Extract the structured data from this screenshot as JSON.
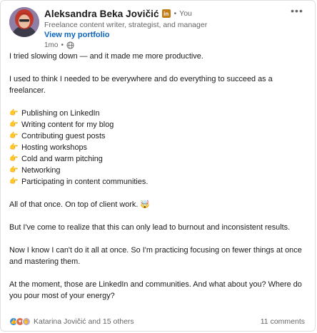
{
  "author": {
    "name": "Aleksandra Beka Jovičić",
    "badge": "in",
    "relation": "You",
    "headline": "Freelance content writer, strategist, and manager",
    "link": "View my portfolio",
    "time": "1mo",
    "visibility_icon": "globe-icon"
  },
  "menu_icon": "more-horizontal-icon",
  "post": {
    "intro": "I tried slowing down — and it made me more productive.",
    "p1": "I used to think I needed to be everywhere and do everything to succeed as a freelancer.",
    "bullet_icon": "👉",
    "bullets": [
      "Publishing on LinkedIn",
      "Writing content for my blog",
      "Contributing guest posts",
      "Hosting workshops",
      "Cold and warm pitching",
      "Networking",
      "Participating in content communities."
    ],
    "p2": "All of that once. On top of client work. 🤯",
    "p3": "But I've come to realize that this can only lead to burnout and inconsistent results.",
    "p4": "Now I know I can't do it all at once. So I'm practicing focusing on fewer things at once and mastering them.",
    "p5": "At the moment, those are LinkedIn and communities. And what about you? Where do you pour most of your energy?"
  },
  "footer": {
    "reaction_icons": [
      "like-icon",
      "love-icon",
      "support-icon"
    ],
    "reactors": "Katarina Jovičić and 15 others",
    "comments": "11 comments"
  },
  "colors": {
    "link": "#0a66c2",
    "muted": "#666666",
    "badge": "#c37d16",
    "like": "#378fe9",
    "love": "#df704d",
    "support": "#bba9d1"
  }
}
